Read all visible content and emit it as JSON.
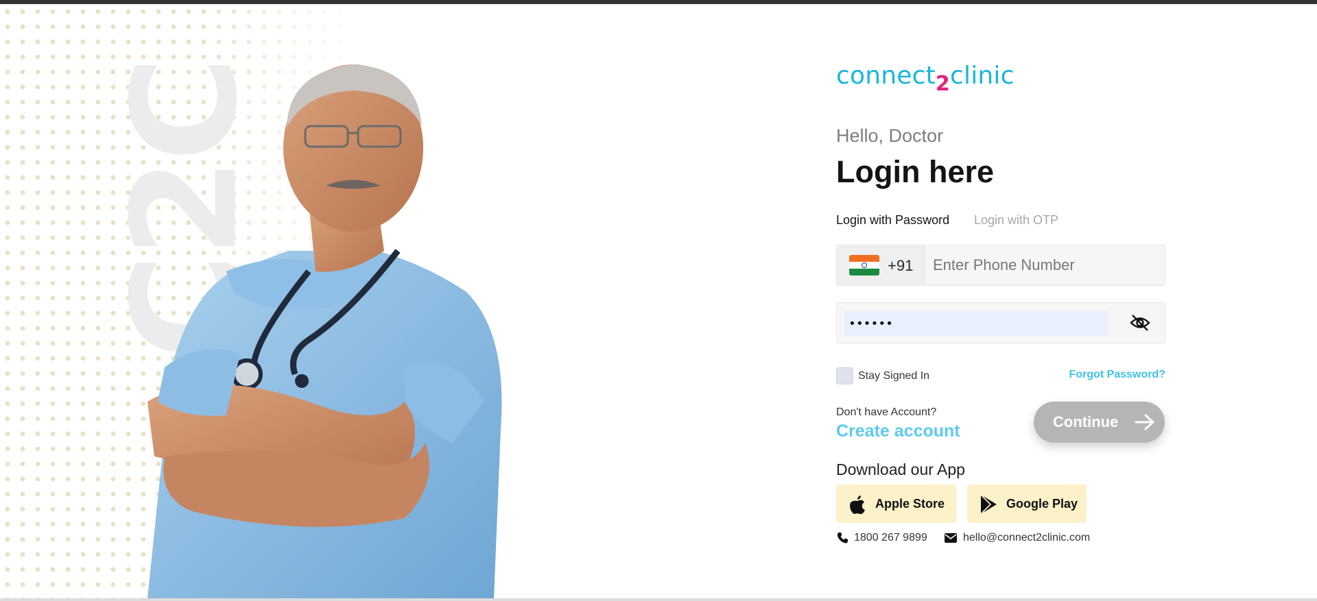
{
  "brand": {
    "logo_before": "connect",
    "logo_number": "2",
    "logo_after": "clinic",
    "watermark": "C2C",
    "colors": {
      "logo_cyan": "#19b6d9",
      "logo_pink": "#e0247b",
      "link_blue": "#3fc0ea",
      "continue_disabled": "#b5b5b5",
      "store_button_bg": "#fdf1c9"
    }
  },
  "login": {
    "greeting": "Hello, Doctor",
    "title": "Login here",
    "tabs": [
      {
        "label": "Login with Password",
        "active": true
      },
      {
        "label": "Login with OTP",
        "active": false
      }
    ],
    "phone": {
      "country_flag": "india-flag-icon",
      "country_code": "+91",
      "placeholder": "Enter Phone Number",
      "value": ""
    },
    "password": {
      "value": "••••••",
      "toggle_icon": "eye-slash-icon"
    },
    "stay_signed_in": {
      "label": "Stay Signed In",
      "checked": false
    },
    "forgot_password": "Forgot Password?",
    "no_account_text": "Don't have Account?",
    "create_account": "Create account",
    "continue_label": "Continue",
    "continue_icon": "arrow-right-icon"
  },
  "apps": {
    "heading": "Download our App",
    "apple_label": "Apple Store",
    "google_label": "Google Play"
  },
  "contact": {
    "phone": "1800 267 9899",
    "email": "hello@connect2clinic.com"
  }
}
